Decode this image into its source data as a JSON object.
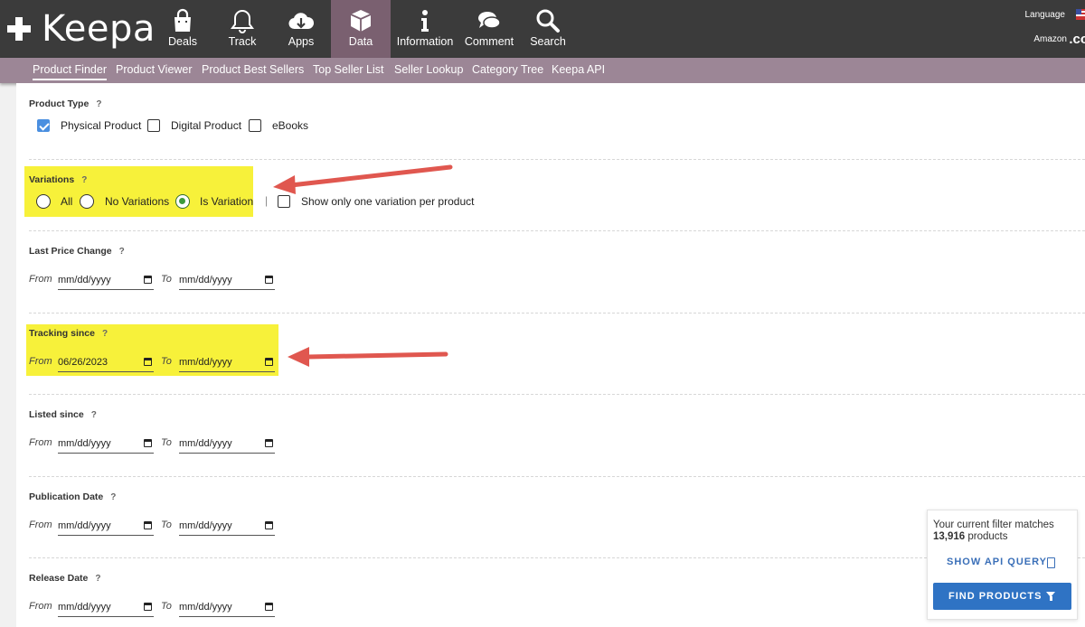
{
  "header": {
    "brand": "Keepa",
    "nav": [
      {
        "label": "Deals",
        "icon": "shopping-bag-icon"
      },
      {
        "label": "Track",
        "icon": "bell-icon"
      },
      {
        "label": "Apps",
        "icon": "cloud-download-icon"
      },
      {
        "label": "Data",
        "icon": "box-icon"
      },
      {
        "label": "Information",
        "icon": "info-icon"
      },
      {
        "label": "Comment",
        "icon": "comments-icon"
      },
      {
        "label": "Search",
        "icon": "search-icon"
      }
    ],
    "active_nav": "Data",
    "language_label": "Language",
    "amazon_label": "Amazon",
    "domain_suffix": ".co"
  },
  "subnav": [
    "Product Finder",
    "Product Viewer",
    "Product Best Sellers",
    "Top Seller List",
    "Seller Lookup",
    "Category Tree",
    "Keepa API"
  ],
  "active_subnav": "Product Finder",
  "filters": {
    "product_type": {
      "label": "Product Type",
      "help": "?",
      "options": [
        {
          "label": "Physical Product",
          "checked": true
        },
        {
          "label": "Digital Product",
          "checked": false
        },
        {
          "label": "eBooks",
          "checked": false
        }
      ]
    },
    "variations": {
      "label": "Variations",
      "help": "?",
      "options": [
        {
          "label": "All",
          "selected": false
        },
        {
          "label": "No Variations",
          "selected": false
        },
        {
          "label": "Is Variation",
          "selected": true
        }
      ],
      "separator": "|",
      "one_per_product_label": "Show only one variation per product",
      "one_per_product_checked": false
    },
    "date_from_label": "From",
    "date_to_label": "To",
    "date_placeholder": "mm/dd/yyyy",
    "last_price_change": {
      "label": "Last Price Change",
      "help": "?",
      "from": "mm/dd/yyyy",
      "to": "mm/dd/yyyy"
    },
    "tracking_since": {
      "label": "Tracking since",
      "help": "?",
      "from": "06/26/2023",
      "to": "mm/dd/yyyy"
    },
    "listed_since": {
      "label": "Listed since",
      "help": "?",
      "from": "mm/dd/yyyy",
      "to": "mm/dd/yyyy"
    },
    "publication_date": {
      "label": "Publication Date",
      "help": "?",
      "from": "mm/dd/yyyy",
      "to": "mm/dd/yyyy"
    },
    "release_date": {
      "label": "Release Date",
      "help": "?",
      "from": "mm/dd/yyyy",
      "to": "mm/dd/yyyy"
    }
  },
  "match": {
    "text": "Your current filter matches",
    "count": "13,916",
    "unit": "products",
    "show_api_query": "SHOW API QUERY",
    "find_products": "FIND PRODUCTS"
  },
  "colors": {
    "topbar": "#3b3b3b",
    "active_nav": "#7a6070",
    "subnav": "#9c8696",
    "highlight": "#f7f13a",
    "annotation_arrow": "#e0574f",
    "primary_button": "#2f73c4"
  }
}
